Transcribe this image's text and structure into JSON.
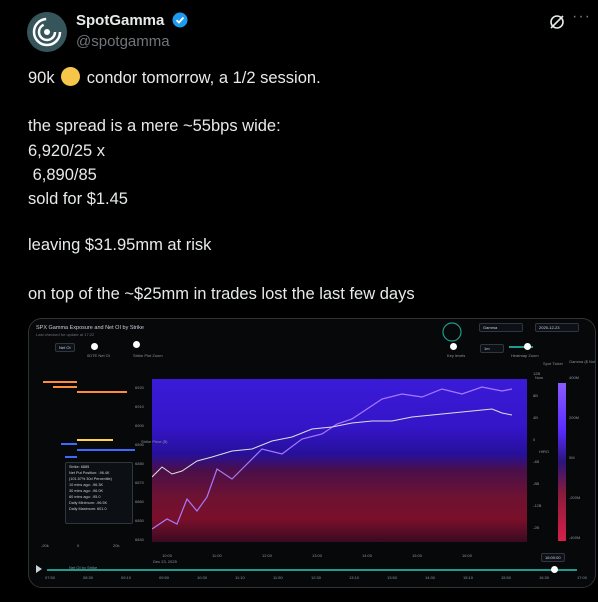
{
  "tweet": {
    "author_name": "SpotGamma",
    "handle": "@spotgamma",
    "lines": [
      "90k",
      "condor tomorrow, a 1/2 session.",
      "the spread is a mere ~55bps wide:",
      "6,920/25 x",
      " 6,890/85",
      "sold for $1.45",
      "leaving $31.95mm at risk",
      "on top of the ~$25mm in trades lost the last few days"
    ],
    "more_label": "···"
  },
  "chart": {
    "title": "SPX Gamma Exposure and Net OI by Strike",
    "subtitle": "Last checked for update at 17:22",
    "control_net_oi": "Net OI",
    "toggle_label_1": "0DTE Net OI",
    "toggle_label_2": "Strike Plot Zoom",
    "dropdown_gamma": "Gamma",
    "date": "2025-12-23",
    "toggle_key_levels": "Key levels",
    "dropdown_interval": "1m",
    "heatmap_zoom": "Heatmap Zoom",
    "now_label": "Now",
    "spot_label": "Spot Ticker",
    "y_axis_label": "Strike Price ($)",
    "x_axis_label": "Net OI by Strike",
    "right_axis_label": "Gamma ($ Notional)",
    "hiro_label": "HIRO",
    "y_ticks": [
      "6920",
      "6910",
      "6900",
      "6890",
      "6880",
      "6870",
      "6860",
      "6850",
      "6840"
    ],
    "x_ticks": [
      "10:00",
      "11:00",
      "12:00",
      "13:00",
      "14:00",
      "15:00",
      "16:00"
    ],
    "x_date": "Dec 23, 2025",
    "hiro_ticks": [
      "12B",
      "8B",
      "4B",
      "0",
      "-4B",
      "-8B",
      "-12B",
      "-2B"
    ],
    "gamma_ticks": [
      "400M",
      "200M",
      "0M",
      "-200M",
      "-400M"
    ],
    "bar_scale": [
      "-20k",
      "0",
      "20k"
    ],
    "tooltip": [
      "Strike: 6885",
      "Net Put Position: -96.4K",
      "(101.57% 30d Percentile)",
      "10 mins ago: -96.3K",
      "30 mins ago: -96.0K",
      "60 mins ago: -95.0",
      "Daily Minimum: -96.5K",
      "Daily Maximum: 601.0"
    ],
    "time_badge": "16:00:00",
    "timeline_ticks": [
      "07:50",
      "08:30",
      "09:10",
      "09:50",
      "10:30",
      "11:10",
      "11:50",
      "12:30",
      "13:10",
      "13:50",
      "14:30",
      "15:10",
      "15:50",
      "16:30",
      "17:00"
    ],
    "accent": "#1f9a8f"
  }
}
